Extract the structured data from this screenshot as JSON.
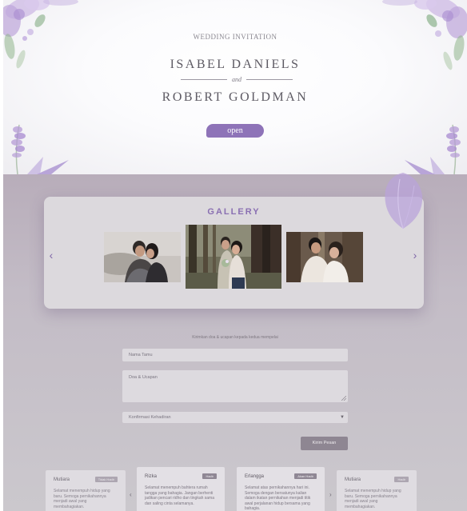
{
  "hero": {
    "subtitle": "WEDDING INVITATION",
    "groom_name": "ISABEL DANIELS",
    "connector": "and",
    "bride_name": "ROBERT GOLDMAN",
    "open_label": "open"
  },
  "gallery": {
    "title": "GALLERY",
    "prev_icon": "‹",
    "next_icon": "›"
  },
  "form": {
    "faded_text": "Kirimkan doa & ucapan kepada kedua mempelai",
    "name_placeholder": "Nama Tamu",
    "message_placeholder": "Doa & Ucapan",
    "attendance_value": "Konfirmasi Kehadiran",
    "submit_label": "Kirim Pesan"
  },
  "wishes": [
    {
      "name": "Mutiara",
      "badge": "Tidak Hadir",
      "text": "Selamat menempuh hidup yang baru. Semoga pernikahannya menjadi awal yang membahagiakan."
    },
    {
      "name": "Rizka",
      "badge": "Hadir",
      "text": "Selamat menempuh bahtera rumah tangga yang bahagia. Jangan berhenti jadikan pencari ridho dan tingkah sama dan saling cinta selamanya."
    },
    {
      "name": "Erlangga",
      "badge": "Akan Hadir",
      "text": "Selamat atas pernikahannya hari ini. Semoga dengan bersatunya kalian dalam ikatan pernikahan menjadi titik awal perjalanan hidup bersama yang bahagia."
    },
    {
      "name": "Mutiara",
      "badge": "Hadir",
      "text": "Selamat menempuh hidup yang baru. Semoga pernikahannya menjadi awal yang membahagiakan."
    }
  ],
  "wish_nav": {
    "prev_icon": "‹",
    "next_icon": "›"
  },
  "colors": {
    "accent": "#8e73b8",
    "lower_bg": "#c3bcc6",
    "card_bg": "#dcd9dd"
  },
  "icons": {
    "prev": "chevron-left-icon",
    "next": "chevron-right-icon",
    "select": "caret-down-icon",
    "resize": "resize-handle-icon"
  }
}
